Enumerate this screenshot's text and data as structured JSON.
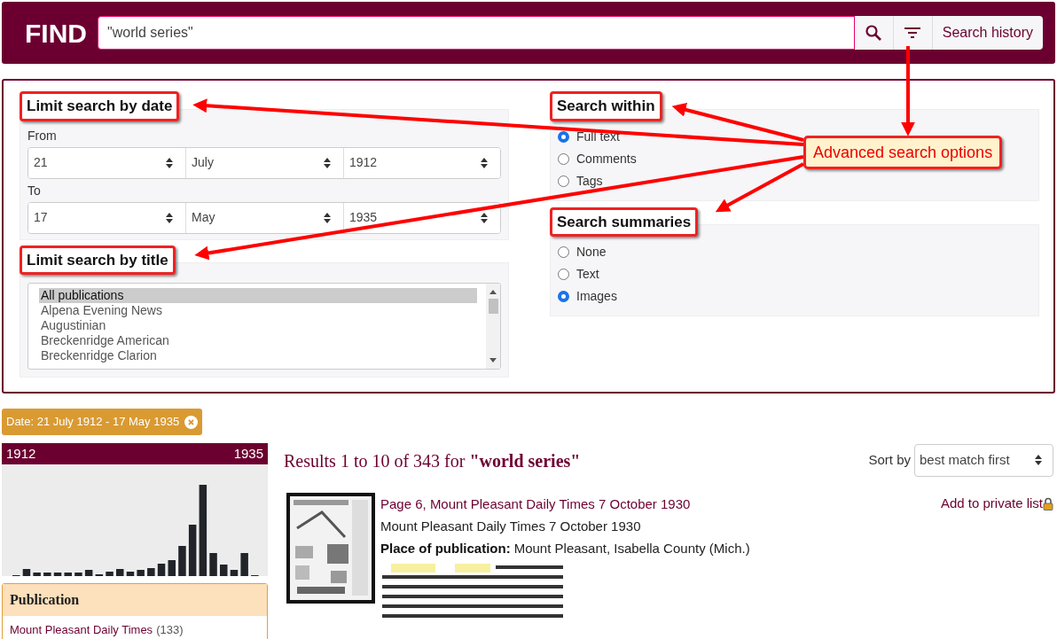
{
  "header": {
    "logo": "FIND",
    "search_value": "\"world series\"",
    "history_button": "Search history"
  },
  "advanced": {
    "date": {
      "heading": "Limit search by date",
      "from_label": "From",
      "from": [
        "21",
        "July",
        "1912"
      ],
      "to_label": "To",
      "to": [
        "17",
        "May",
        "1935"
      ]
    },
    "title": {
      "heading": "Limit search by title",
      "options": [
        {
          "label": "All publications",
          "selected": true
        },
        {
          "label": "Alpena Evening News",
          "selected": false
        },
        {
          "label": "Augustinian",
          "selected": false
        },
        {
          "label": "Breckenridge American",
          "selected": false
        },
        {
          "label": "Breckenridge Clarion",
          "selected": false
        }
      ]
    },
    "within": {
      "heading": "Search within",
      "options": [
        {
          "label": "Full text",
          "selected": true
        },
        {
          "label": "Comments",
          "selected": false
        },
        {
          "label": "Tags",
          "selected": false
        }
      ]
    },
    "summaries": {
      "heading": "Search summaries",
      "options": [
        {
          "label": "None",
          "selected": false
        },
        {
          "label": "Text",
          "selected": false
        },
        {
          "label": "Images",
          "selected": true
        }
      ]
    }
  },
  "annotation": {
    "callout": "Advanced search options"
  },
  "filter_chip": {
    "label": "Date: 21 July 1912 - 17 May 1935"
  },
  "timeline": {
    "start": "1912",
    "end": "1935"
  },
  "facet": {
    "heading": "Publication",
    "items": [
      {
        "label": "Mount Pleasant Daily Times",
        "count": "(133)"
      }
    ]
  },
  "results": {
    "summary": "Results 1 to 10 of 343 for **\"world series\"**",
    "sort_label": "Sort by",
    "sort_value": "best match first",
    "items": [
      {
        "title": "Page 6, Mount Pleasant Daily Times 7 October 1930",
        "source": "Mount Pleasant Daily Times 7 October 1930",
        "place_label": "Place of publication:",
        "place": "Mount Pleasant, Isabella County (Mich.)",
        "action": "Add to private list"
      }
    ]
  }
}
